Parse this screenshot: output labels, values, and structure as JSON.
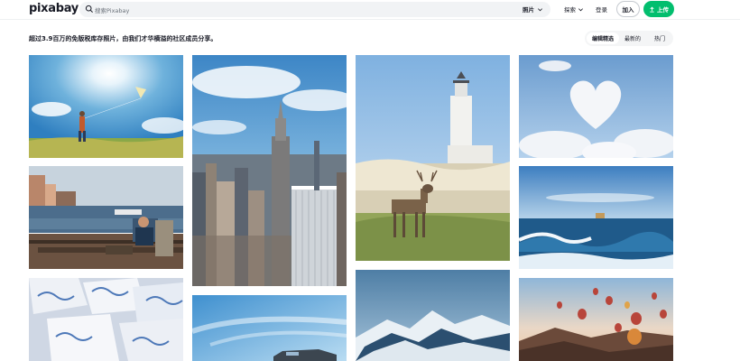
{
  "header": {
    "logo": "pixabay",
    "search_placeholder": "搜索Pixabay",
    "category": "照片",
    "explore": "探索",
    "login": "登录",
    "join": "加入",
    "upload": "上传"
  },
  "main": {
    "tagline": "超过3.9百万的免版税库存照片，由我们才华横溢的社区成员分享。",
    "sort_tabs": [
      {
        "label": "编辑精选",
        "active": true
      },
      {
        "label": "最新的",
        "active": false
      },
      {
        "label": "热门",
        "active": false
      }
    ]
  },
  "photos": [
    {
      "name": "photo-kite-child"
    },
    {
      "name": "photo-new-york-city"
    },
    {
      "name": "photo-lighthouse-deer"
    },
    {
      "name": "photo-heart-cloud"
    },
    {
      "name": "photo-harbor-man"
    },
    {
      "name": "photo-ocean-wave"
    },
    {
      "name": "photo-gift-boxes"
    },
    {
      "name": "photo-car-sky"
    },
    {
      "name": "photo-snowy-mountain"
    },
    {
      "name": "photo-hot-air-balloons"
    }
  ],
  "colors": {
    "accent": "#02be6e",
    "text": "#191b26",
    "search_bg": "#f1f3f5"
  }
}
